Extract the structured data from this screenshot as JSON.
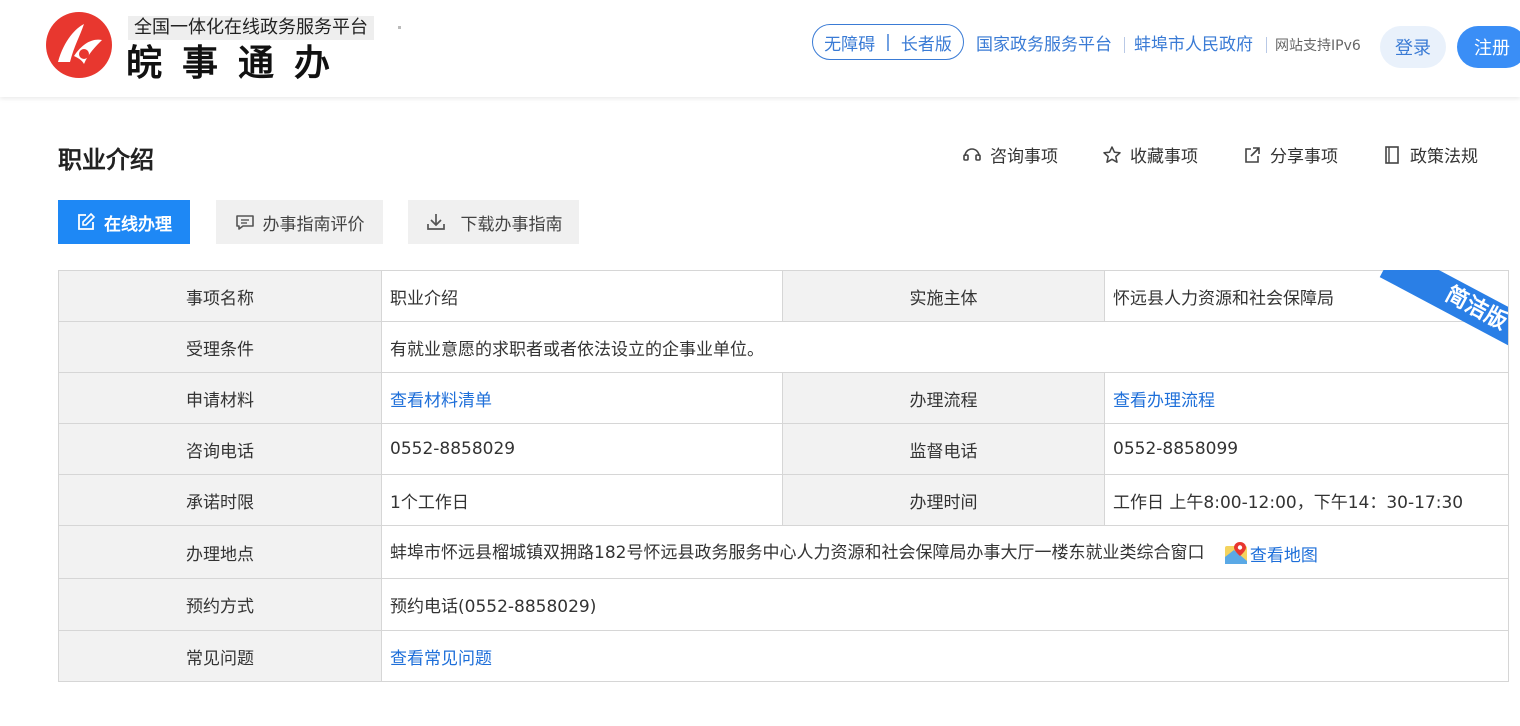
{
  "header": {
    "subtitle": "全国一体化在线政务服务平台",
    "title": "皖事通办",
    "accessibility": {
      "no_barrier": "无障碍",
      "separator": "|",
      "elder": "长者版"
    },
    "links": [
      "国家政务服务平台",
      "蚌埠市人民政府"
    ],
    "ipv6": "网站支持IPv6",
    "login": "登录",
    "register": "注册",
    "brand_color": "#e8372f",
    "accent": "#3a7bd5"
  },
  "page": {
    "title": "职业介绍",
    "tools": [
      {
        "label": "咨询事项",
        "icon": "consult-icon"
      },
      {
        "label": "收藏事项",
        "icon": "star-icon"
      },
      {
        "label": "分享事项",
        "icon": "share-icon"
      },
      {
        "label": "政策法规",
        "icon": "book-icon"
      }
    ],
    "actions": {
      "online": "在线办理",
      "evaluate": "办事指南评价",
      "download": "下载办事指南"
    }
  },
  "ribbon": "简洁版",
  "table": {
    "item_name_label": "事项名称",
    "item_name": "职业介绍",
    "subject_label": "实施主体",
    "subject": "怀远县人力资源和社会保障局",
    "condition_label": "受理条件",
    "condition": "有就业意愿的求职者或者依法设立的企事业单位。",
    "materials_label": "申请材料",
    "materials_link": "查看材料清单",
    "process_label": "办理流程",
    "process_link": "查看办理流程",
    "consult_phone_label": "咨询电话",
    "consult_phone": "0552-8858029",
    "supervise_phone_label": "监督电话",
    "supervise_phone": "0552-8858099",
    "time_limit_label": "承诺时限",
    "time_limit": "1个工作日",
    "hours_label": "办理时间",
    "hours": "工作日 上午8:00-12:00，下午14：30-17:30",
    "location_label": "办理地点",
    "location": "蚌埠市怀远县榴城镇双拥路182号怀远县政务服务中心人力资源和社会保障局办事大厅一楼东就业类综合窗口",
    "map_link": "查看地图",
    "appointment_label": "预约方式",
    "appointment": "预约电话(0552-8858029)",
    "faq_label": "常见问题",
    "faq_link": "查看常见问题"
  }
}
